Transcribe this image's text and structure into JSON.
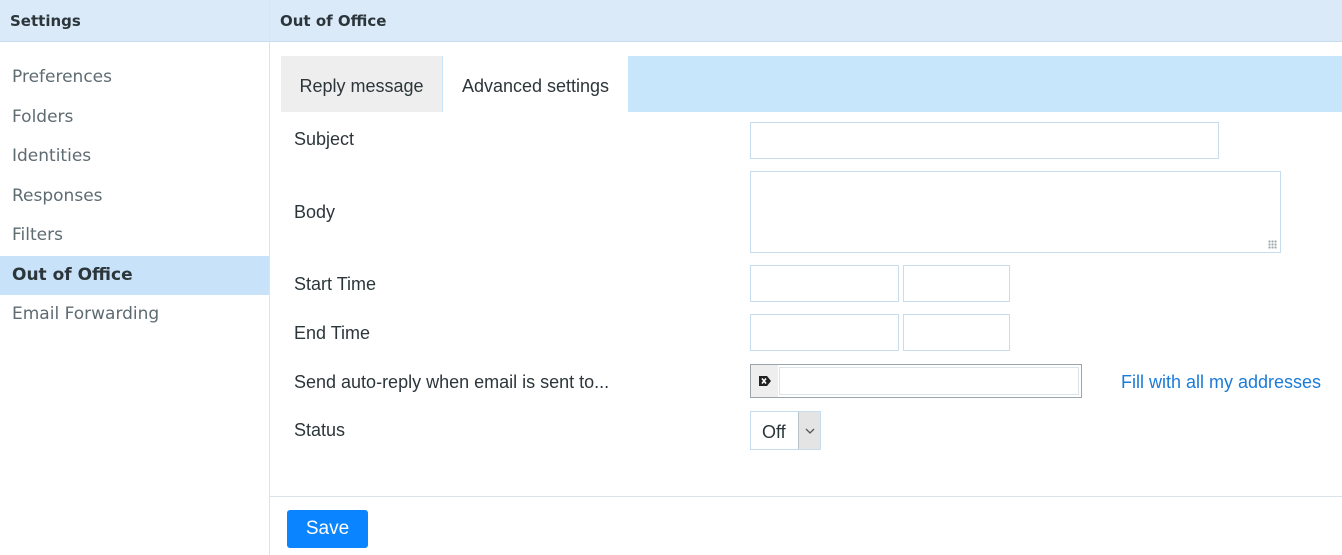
{
  "sidebar": {
    "title": "Settings",
    "items": [
      {
        "label": "Preferences"
      },
      {
        "label": "Folders"
      },
      {
        "label": "Identities"
      },
      {
        "label": "Responses"
      },
      {
        "label": "Filters"
      },
      {
        "label": "Out of Office"
      },
      {
        "label": "Email Forwarding"
      }
    ],
    "selected": "Out of Office"
  },
  "main": {
    "title": "Out of Office",
    "tabs": [
      {
        "label": "Reply message"
      },
      {
        "label": "Advanced settings"
      }
    ],
    "active_tab": "Advanced settings",
    "form": {
      "subject_label": "Subject",
      "subject_value": "",
      "body_label": "Body",
      "body_value": "",
      "start_time_label": "Start Time",
      "start_date_value": "",
      "start_hour_value": "",
      "end_time_label": "End Time",
      "end_date_value": "",
      "end_hour_value": "",
      "recipients_label": "Send auto-reply when email is sent to...",
      "recipients_value": "",
      "fill_link": "Fill with all my addresses",
      "status_label": "Status",
      "status_value": "Off",
      "status_icon": "chevron-down-icon"
    },
    "save_label": "Save"
  },
  "colors": {
    "header_bg": "#daeaf9",
    "selected_bg": "#c8e2fa",
    "tabbar_bg": "#c8e6fb",
    "link": "#1a7bd8",
    "primary": "#0a84ff"
  }
}
